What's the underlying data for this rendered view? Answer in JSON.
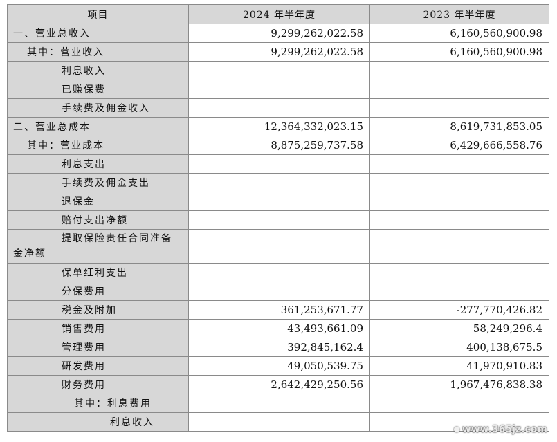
{
  "header": {
    "item": "项目",
    "col_2024": "2024 年半年度",
    "col_2023": "2023 年半年度"
  },
  "rows": [
    {
      "label": "一、营业总收入",
      "v2024": "9,299,262,022.58",
      "v2023": "6,160,560,900.98"
    },
    {
      "label": "其中：营业收入",
      "v2024": "9,299,262,022.58",
      "v2023": "6,160,560,900.98"
    },
    {
      "label": "利息收入",
      "v2024": "",
      "v2023": ""
    },
    {
      "label": "已赚保费",
      "v2024": "",
      "v2023": ""
    },
    {
      "label": "手续费及佣金收入",
      "v2024": "",
      "v2023": ""
    },
    {
      "label": "二、营业总成本",
      "v2024": "12,364,332,023.15",
      "v2023": "8,619,731,853.05"
    },
    {
      "label": "其中：营业成本",
      "v2024": "8,875,259,737.58",
      "v2023": "6,429,666,558.76"
    },
    {
      "label": "利息支出",
      "v2024": "",
      "v2023": ""
    },
    {
      "label": "手续费及佣金支出",
      "v2024": "",
      "v2023": ""
    },
    {
      "label": "退保金",
      "v2024": "",
      "v2023": ""
    },
    {
      "label": "赔付支出净额",
      "v2024": "",
      "v2023": ""
    },
    {
      "label_line1": "提取保险责任合同准备",
      "label_line2": "金净额",
      "v2024": "",
      "v2023": ""
    },
    {
      "label": "保单红利支出",
      "v2024": "",
      "v2023": ""
    },
    {
      "label": "分保费用",
      "v2024": "",
      "v2023": ""
    },
    {
      "label": "税金及附加",
      "v2024": "361,253,671.77",
      "v2023": "-277,770,426.82"
    },
    {
      "label": "销售费用",
      "v2024": "43,493,661.09",
      "v2023": "58,249,296.4"
    },
    {
      "label": "管理费用",
      "v2024": "392,845,162.4",
      "v2023": "400,138,675.5"
    },
    {
      "label": "研发费用",
      "v2024": "49,050,539.75",
      "v2023": "41,970,910.83"
    },
    {
      "label": "财务费用",
      "v2024": "2,642,429,250.56",
      "v2023": "1,967,476,838.38"
    },
    {
      "label": "其中：利息费用",
      "v2024": "",
      "v2023": ""
    },
    {
      "label": "利息收入",
      "v2024": "",
      "v2023": ""
    }
  ],
  "watermark": {
    "text": "www.365jz.com"
  }
}
